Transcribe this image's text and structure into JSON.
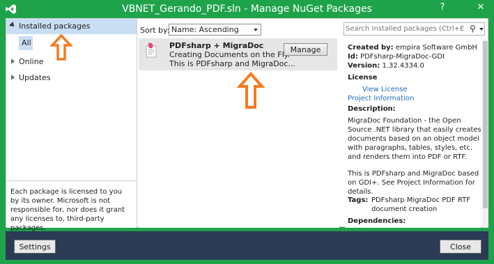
{
  "window": {
    "title": "VBNET_Gerando_PDF.sln - Manage NuGet Packages",
    "help_glyph": "?",
    "close_glyph": "✕",
    "accent_color": "#1fa34a",
    "bottom_bar_color": "#2b3a55"
  },
  "sidebar": {
    "installed_label": "Installed packages",
    "all_label": "All",
    "online_label": "Online",
    "updates_label": "Updates",
    "license_note": "Each package is licensed to you by its owner. Microsoft is not responsible for, nor does it grant any licenses to, third-party packages."
  },
  "toolbar": {
    "sort_label": "Sort by:",
    "sort_value": "Name: Ascending",
    "search_placeholder": "Search Installed packages (Ctrl+E)",
    "search_icon": "search-icon"
  },
  "packages": [
    {
      "name": "PDFsharp + MigraDoc",
      "desc_line1": "Creating Documents on the Fly.",
      "desc_line2": "This is PDFsharp and MigraDoc...",
      "action": "Manage"
    }
  ],
  "details": {
    "created_by_label": "Created by:",
    "created_by": "empira Software GmbH",
    "id_label": "Id:",
    "id": "PDFsharp-MigraDoc-GDI",
    "version_label": "Version:",
    "version": "1.32.4334.0",
    "license_label": "License",
    "view_license": "View License",
    "project_info": "Project Information",
    "description_label": "Description:",
    "description": "MigraDoc Foundation - the Open Source .NET library that easily creates documents based on an object model with paragraphs, tables, styles, etc. and renders them into PDF or RTF.",
    "description2": "This is PDFsharp and MigraDoc based on GDI+. See Project Information for details.",
    "tags_label": "Tags:",
    "tags": "PDFsharp MigraDoc PDF RTF document creation",
    "dependencies_label": "Dependencies:"
  },
  "footer": {
    "settings": "Settings",
    "close": "Close"
  }
}
